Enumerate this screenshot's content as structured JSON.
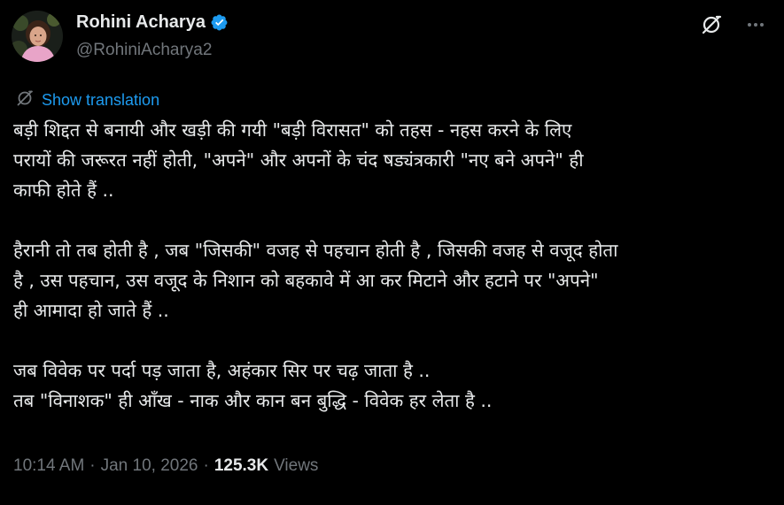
{
  "author": {
    "display_name": "Rohini Acharya",
    "handle": "@RohiniAcharya2",
    "verified": true,
    "verified_color": "#1d9bf0"
  },
  "icons": {
    "grok": "grok-icon",
    "more": "more-options-icon",
    "translate": "translate-icon"
  },
  "translation": {
    "label": "Show translation"
  },
  "post": {
    "paragraphs": [
      [
        "बड़ी शिद्दत से बनायी और खड़ी की गयी \"बड़ी विरासत\" को तहस - नहस करने के लिए",
        "परायों की जरूरत नहीं होती, \"अपने\" और अपनों के चंद षड्यंत्रकारी \"नए बने अपने\" ही",
        "काफी होते हैं .."
      ],
      [
        "हैरानी तो तब होती है , जब \"जिसकी\" वजह से पहचान होती है , जिसकी वजह से वजूद होता",
        "है , उस पहचान, उस वजूद के निशान को बहकावे में आ कर मिटाने और हटाने पर \"अपने\"",
        "ही आमादा हो जाते हैं .."
      ],
      [
        "जब विवेक पर पर्दा पड़ जाता है, अहंकार सिर पर चढ़ जाता है ..",
        "तब \"विनाशक\" ही आँख - नाक और कान बन बुद्धि - विवेक हर लेता है .."
      ]
    ]
  },
  "meta": {
    "time": "10:14 AM",
    "separator1": "·",
    "date": "Jan 10, 2026",
    "separator2": "·",
    "views_count": "125.3K",
    "views_label": "Views"
  }
}
